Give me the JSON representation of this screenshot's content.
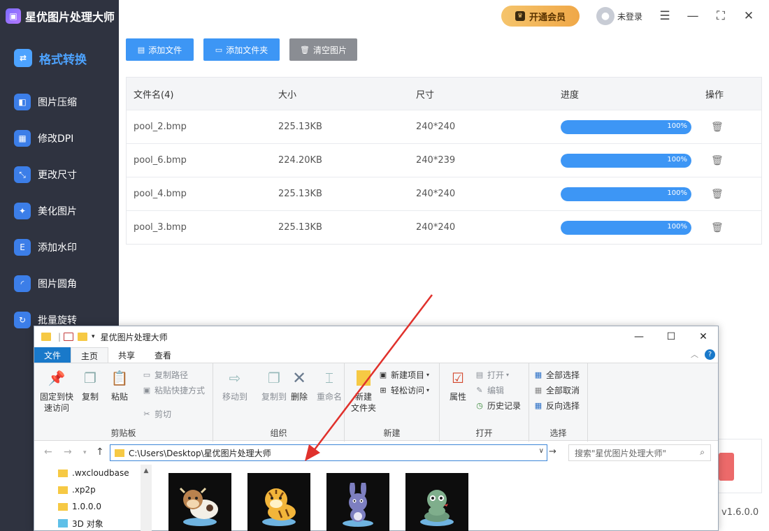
{
  "app": {
    "name": "星优图片处理大师",
    "vip_label": "开通会员",
    "user_label": "未登录",
    "version": "v1.6.0.0"
  },
  "sidebar": {
    "items": [
      {
        "label": "格式转换",
        "icon": "format-convert-icon",
        "active": true
      },
      {
        "label": "图片压缩",
        "icon": "compress-icon"
      },
      {
        "label": "修改DPI",
        "icon": "dpi-icon"
      },
      {
        "label": "更改尺寸",
        "icon": "resize-icon"
      },
      {
        "label": "美化图片",
        "icon": "beautify-icon"
      },
      {
        "label": "添加水印",
        "icon": "watermark-icon"
      },
      {
        "label": "图片圆角",
        "icon": "round-corner-icon"
      },
      {
        "label": "批量旋转",
        "icon": "rotate-icon"
      }
    ]
  },
  "toolbar": {
    "add_file": "添加文件",
    "add_folder": "添加文件夹",
    "clear": "清空图片"
  },
  "table": {
    "headers": [
      "文件名(4)",
      "大小",
      "尺寸",
      "进度",
      "操作"
    ],
    "rows": [
      {
        "name": "pool_2.bmp",
        "size": "225.13KB",
        "dim": "240*240",
        "progress": "100%",
        "progress_value": 1.0
      },
      {
        "name": "pool_6.bmp",
        "size": "224.20KB",
        "dim": "240*239",
        "progress": "100%",
        "progress_value": 1.0
      },
      {
        "name": "pool_4.bmp",
        "size": "225.13KB",
        "dim": "240*240",
        "progress": "100%",
        "progress_value": 1.0
      },
      {
        "name": "pool_3.bmp",
        "size": "225.13KB",
        "dim": "240*240",
        "progress": "100%",
        "progress_value": 1.0
      }
    ]
  },
  "explorer": {
    "title": "星优图片处理大师",
    "tabs": [
      "文件",
      "主页",
      "共享",
      "查看"
    ],
    "ribbon": {
      "clipboard": {
        "label": "剪贴板",
        "pin": "固定到快速访问",
        "pin_line1": "固定到快",
        "pin_line2": "速访问",
        "copy": "复制",
        "paste": "粘贴",
        "copy_path": "复制路径",
        "paste_shortcut": "粘贴快捷方式",
        "cut": "剪切"
      },
      "organize": {
        "label": "组织",
        "move_to": "移动到",
        "copy_to": "复制到",
        "delete": "删除",
        "rename": "重命名"
      },
      "new": {
        "label": "新建",
        "new_folder_line1": "新建",
        "new_folder_line2": "文件夹",
        "new_item": "新建项目",
        "easy_access": "轻松访问"
      },
      "open": {
        "label": "打开",
        "properties": "属性",
        "open": "打开",
        "edit": "编辑",
        "history": "历史记录"
      },
      "select": {
        "label": "选择",
        "select_all": "全部选择",
        "select_none": "全部取消",
        "invert": "反向选择"
      }
    },
    "address": "C:\\Users\\Desktop\\星优图片处理大师",
    "search_placeholder": "搜索\"星优图片处理大师\"",
    "tree": [
      {
        "label": ".wxcloudbase",
        "icon": "folder-icon"
      },
      {
        "label": ".xp2p",
        "icon": "folder-icon"
      },
      {
        "label": "1.0.0.0",
        "icon": "folder-icon"
      },
      {
        "label": "3D 对象",
        "icon": "3d-objects-icon"
      }
    ]
  },
  "colors": {
    "accent": "#3d96f5",
    "sidebar_bg": "#2f3340",
    "annotation_arrow": "#e0312c"
  }
}
